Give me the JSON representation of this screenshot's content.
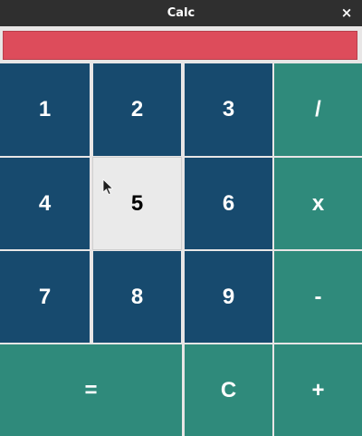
{
  "window": {
    "title": "Calc",
    "close_label": "×"
  },
  "display": {
    "value": ""
  },
  "keys": {
    "k1": "1",
    "k2": "2",
    "k3": "3",
    "divide": "/",
    "k4": "4",
    "k5": "5",
    "k6": "6",
    "multiply": "x",
    "k7": "7",
    "k8": "8",
    "k9": "9",
    "minus": "-",
    "equals": "=",
    "clear": "C",
    "plus": "+"
  },
  "colors": {
    "titlebar": "#2f2f2f",
    "display": "#dd4c5b",
    "number_key": "#174a6e",
    "operator_key": "#2f8a7b",
    "hover_key": "#eaeaea"
  }
}
